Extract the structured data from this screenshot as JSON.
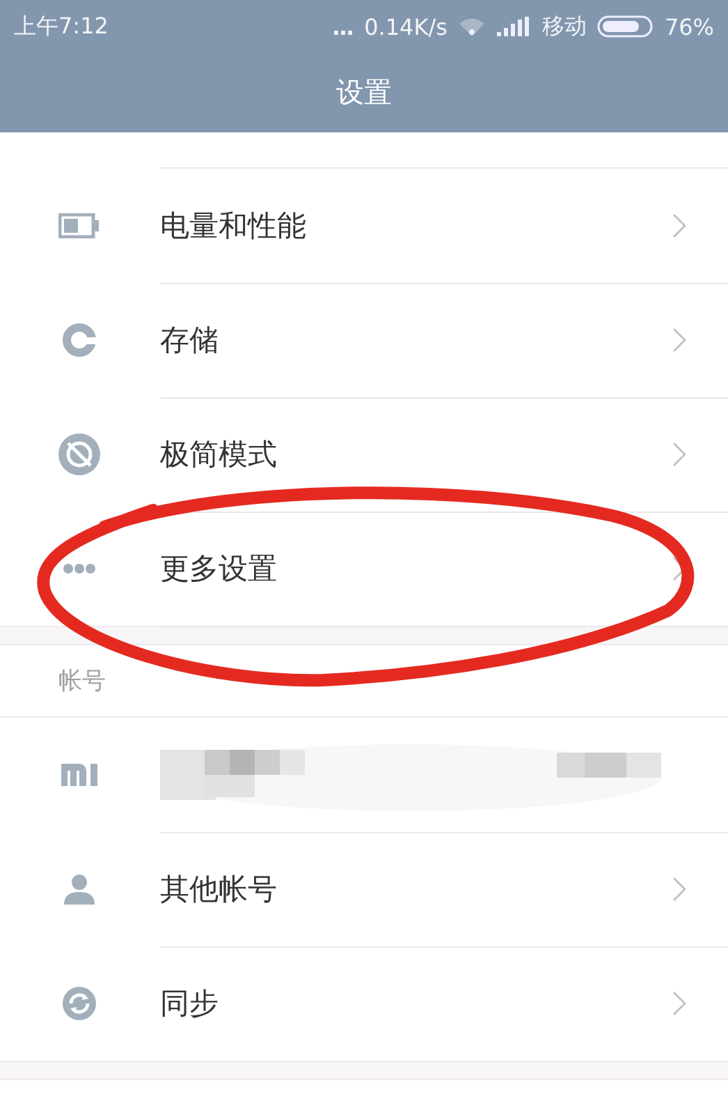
{
  "status_bar": {
    "time": "上午7:12",
    "activity": "...",
    "network_speed": "0.14K/s",
    "carrier": "移动",
    "battery_percent": "76%"
  },
  "title": "设置",
  "sections": [
    {
      "items": [
        {
          "kind": "link",
          "label": "电量和性能"
        },
        {
          "kind": "link",
          "label": "存储"
        },
        {
          "kind": "link",
          "label": "极简模式"
        },
        {
          "kind": "link",
          "label": "更多设置"
        }
      ]
    },
    {
      "header": "帐号",
      "items": [
        {
          "kind": "redacted"
        },
        {
          "kind": "link",
          "label": "其他帐号"
        },
        {
          "kind": "link",
          "label": "同步"
        }
      ]
    }
  ],
  "annotation": {
    "kind": "ellipse"
  }
}
